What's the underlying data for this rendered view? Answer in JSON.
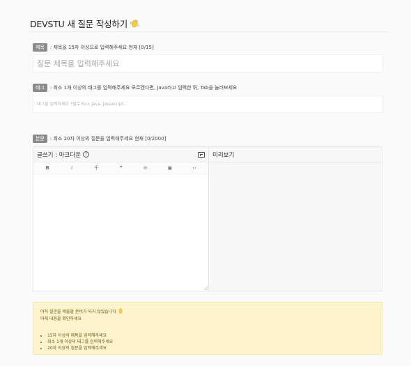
{
  "page": {
    "title": "DEVSTU 새 질문 작성하기",
    "title_icon": "waving-hand-icon"
  },
  "title_field": {
    "badge": "제목",
    "hint": ": 제목을 15자 이상으로 입력해주세요 현재 [0/15]",
    "placeholder": "질문 제목을 입력해주세요",
    "value": ""
  },
  "tag_field": {
    "badge": "태그",
    "hint": ": 최소 1개 이상의 태그를 입력해주세요 모르겠다면, Java라고 입력한 뒤, Tab을 눌러보세요",
    "placeholder": "태그를 입력하세요 *필수 Ex> Java, Javascript...",
    "value": ""
  },
  "body_field": {
    "badge": "본문",
    "hint": ": 최소 20자 이상의 질문을 입력해주세요 현재 [0/2000]"
  },
  "editor": {
    "write_label": "글쓰기 : 마크다운",
    "help_icon": "question-circle-icon",
    "expand_icon": "expand-icon",
    "preview_label": "미리보기",
    "toolbar": {
      "bold": "B",
      "italic": "I",
      "strike": "千",
      "quote": "❞",
      "link": "⊖",
      "image": "▣",
      "code": "‹›"
    },
    "toolbar_icons": [
      "bold-icon",
      "italic-icon",
      "strikethrough-icon",
      "quote-icon",
      "link-icon",
      "image-icon",
      "code-icon"
    ],
    "content": ""
  },
  "notice": {
    "line1": "아직 질문을 제출할 준비가 되지 않았습니다",
    "line1_icon": "hand-icon",
    "line2": "아래 내용을 확인하세요",
    "items": [
      "15자 이상의 제목을 입력해주세요",
      "최소 1개 이상의 태그를 입력해주세요",
      "20자 이상의 질문을 입력해주세요"
    ]
  },
  "colors": {
    "badge": "#8a8a8a",
    "notice_bg": "#fdf3cc",
    "notice_text": "#6b5a1e"
  }
}
